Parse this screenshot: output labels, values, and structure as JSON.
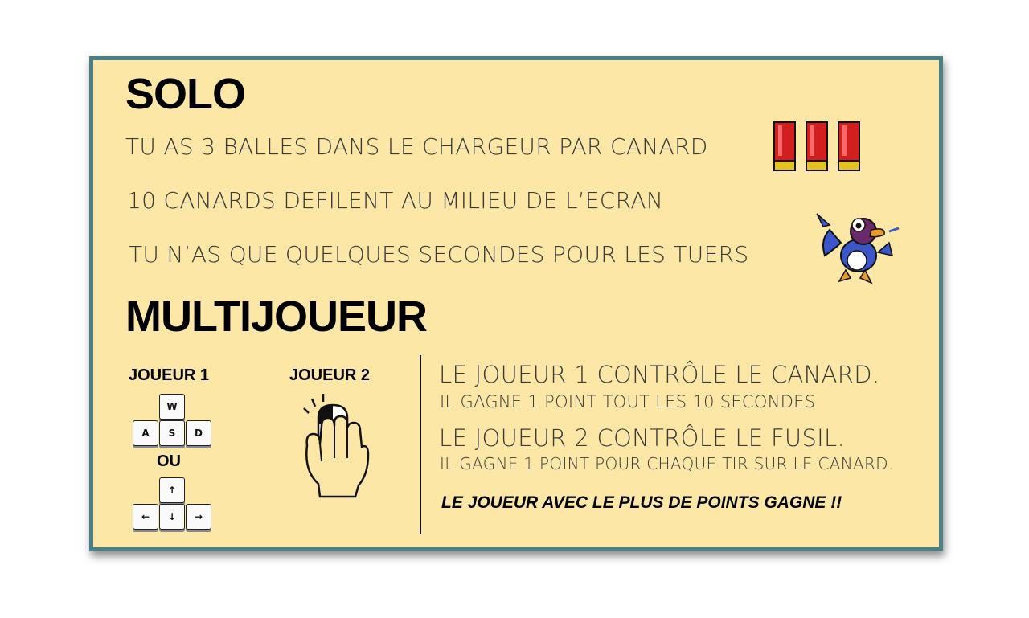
{
  "solo": {
    "title": "SOLO",
    "lines": [
      "TU AS 3 BALLES DANS LE CHARGEUR PAR CANARD",
      "10 CANARDS DEFILENT AU MILIEU DE L’ECRAN",
      "TU N’AS QUE QUELQUES SECONDES POUR LES TUERS"
    ],
    "shells": 3
  },
  "multi": {
    "title": "MULTIJOUEUR",
    "player1": {
      "label": "JOUEUR 1",
      "keys_wasd": [
        "W",
        "A",
        "S",
        "D"
      ],
      "or_label": "OU",
      "keys_arrows": [
        "↑",
        "←",
        "↓",
        "→"
      ]
    },
    "player2": {
      "label": "JOUEUR 2",
      "icon": "mouse-hand-icon"
    },
    "rules": {
      "p1_title": "LE JOUEUR 1 CONTRÔLE LE CANARD.",
      "p1_sub": "IL GAGNE 1 POINT  TOUT LES 10 SECONDES",
      "p2_title": "LE JOUEUR 2 CONTRÔLE LE FUSIL.",
      "p2_sub": "IL GAGNE 1 POINT POUR CHAQUE TIR SUR LE CANARD.",
      "winner": "LE JOUEUR AVEC LE PLUS DE POINTS GAGNE !!"
    }
  },
  "colors": {
    "card_bg": "#fde7a6",
    "border": "#4a7f86",
    "shell_red": "#d21e1e",
    "shell_brass": "#e6c21f",
    "duck_blue": "#3b56c9"
  }
}
